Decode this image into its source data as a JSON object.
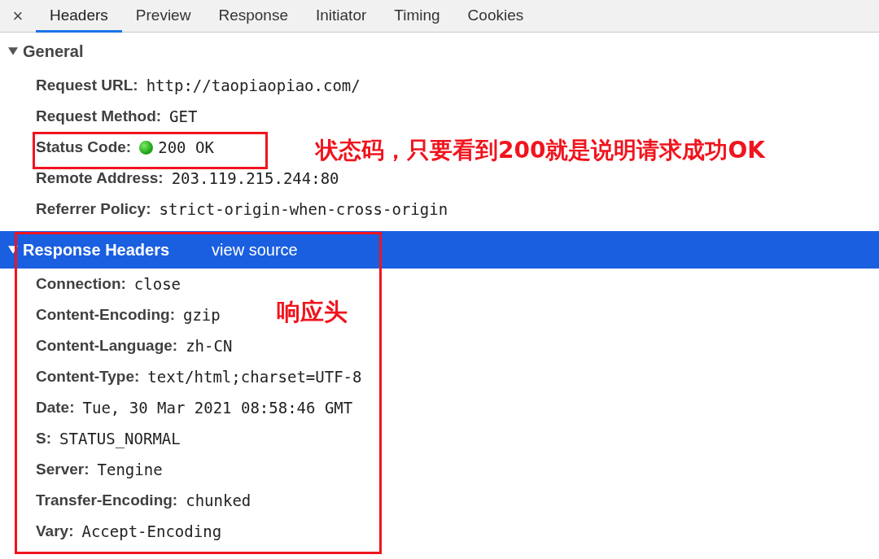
{
  "close_label": "×",
  "tabs": [
    {
      "label": "Headers",
      "selected": true
    },
    {
      "label": "Preview",
      "selected": false
    },
    {
      "label": "Response",
      "selected": false
    },
    {
      "label": "Initiator",
      "selected": false
    },
    {
      "label": "Timing",
      "selected": false
    },
    {
      "label": "Cookies",
      "selected": false
    }
  ],
  "sections": [
    {
      "title": "General",
      "expanded": true,
      "highlighted": false,
      "rows": [
        {
          "key": "Request URL:",
          "value": "http://taopiaopiao.com/"
        },
        {
          "key": "Request Method:",
          "value": "GET"
        },
        {
          "key": "Status Code:",
          "value": "200 OK",
          "status_dot": true
        },
        {
          "key": "Remote Address:",
          "value": "203.119.215.244:80"
        },
        {
          "key": "Referrer Policy:",
          "value": "strict-origin-when-cross-origin"
        }
      ]
    },
    {
      "title": "Response Headers",
      "link": "view source",
      "expanded": true,
      "highlighted": true,
      "rows": [
        {
          "key": "Connection:",
          "value": "close"
        },
        {
          "key": "Content-Encoding:",
          "value": "gzip"
        },
        {
          "key": "Content-Language:",
          "value": "zh-CN"
        },
        {
          "key": "Content-Type:",
          "value": "text/html;charset=UTF-8"
        },
        {
          "key": "Date:",
          "value": "Tue, 30 Mar 2021 08:58:46 GMT"
        },
        {
          "key": "S:",
          "value": "STATUS_NORMAL"
        },
        {
          "key": "Server:",
          "value": "Tengine"
        },
        {
          "key": "Transfer-Encoding:",
          "value": "chunked"
        },
        {
          "key": "Vary:",
          "value": "Accept-Encoding"
        }
      ]
    }
  ],
  "annotations": [
    {
      "kind": "frame"
    },
    {
      "kind": "frame"
    },
    {
      "kind": "note",
      "text": "状态码，只要看到200就是说明请求成功OK"
    },
    {
      "kind": "note",
      "text": "响应头"
    }
  ]
}
